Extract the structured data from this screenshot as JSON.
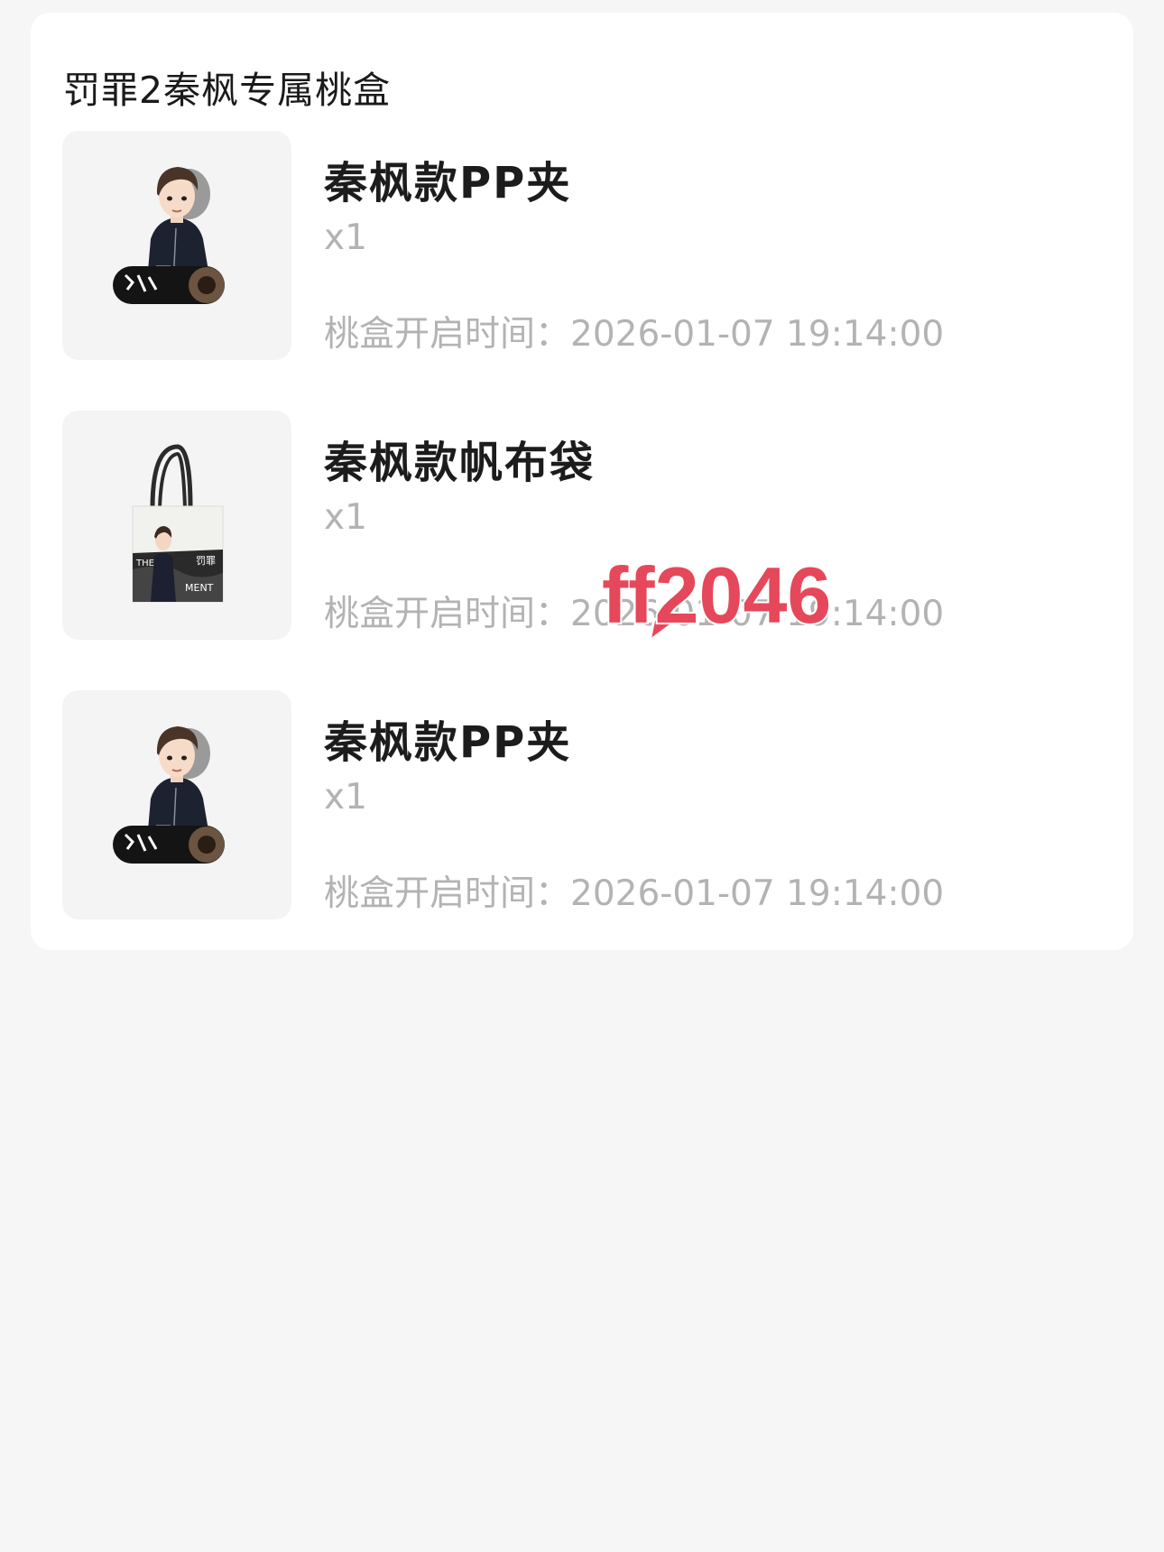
{
  "card": {
    "title": "罚罪2秦枫专属桃盒"
  },
  "items": [
    {
      "name": "秦枫款PP夹",
      "qty": "x1",
      "time_label": "桃盒开启时间：",
      "time_value": "2026-01-07 19:14:00",
      "thumb_icon": "character-clip-image"
    },
    {
      "name": "秦枫款帆布袋",
      "qty": "x1",
      "time_label": "桃盒开启时间：",
      "time_value": "2026-01-07 19:14:00",
      "thumb_icon": "tote-bag-image"
    },
    {
      "name": "秦枫款PP夹",
      "qty": "x1",
      "time_label": "桃盒开启时间：",
      "time_value": "2026-01-07 19:14:00",
      "thumb_icon": "character-clip-image"
    }
  ],
  "watermark": {
    "text": "ff2046",
    "color": "#e5485a"
  },
  "colors": {
    "page_bg": "#f6f6f6",
    "card_bg": "#ffffff",
    "thumb_bg": "#f4f4f4",
    "muted_text": "#b3b3b3",
    "primary_text": "#1c1c1c"
  }
}
